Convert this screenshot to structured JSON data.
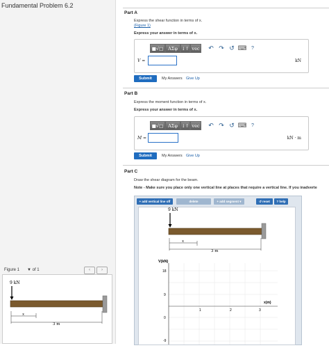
{
  "left": {
    "problem_title": "Fundamental Problem 6.2",
    "figure_label": "Figure 1",
    "figure_of": "of 1",
    "figure": {
      "load_label": "9 kN",
      "x_label": "x",
      "length_label": "3 m"
    }
  },
  "part_a": {
    "title": "Part A",
    "prompt": "Express the shear function in terms of x.",
    "figure_link": "(Figure 1)",
    "instruction": "Express your answer in terms of x.",
    "variable": "V =",
    "input_value": "",
    "unit": "kN",
    "submit": "Submit",
    "my_answers": "My Answers",
    "give_up": "Give Up"
  },
  "part_b": {
    "title": "Part B",
    "prompt": "Express the moment function in terms of x.",
    "instruction": "Express your answer in terms of x.",
    "variable": "M =",
    "input_value": "",
    "unit": "kN · m",
    "submit": "Submit",
    "my_answers": "My Answers",
    "give_up": "Give Up"
  },
  "toolbar": {
    "templates": "■√□",
    "greek": "ΑΣφ",
    "arrows": "↓↑",
    "vec": "vec",
    "undo": "↶",
    "redo": "↷",
    "reset": "↺",
    "keyboard": "⌨",
    "help": "?"
  },
  "part_c": {
    "title": "Part C",
    "prompt": "Draw the shear diagram for the beam.",
    "note": "Note - Make sure you place only one vertical line at places that require a vertical line. If you inadverte",
    "tools": {
      "add_vertical": "+ add vertical line off",
      "delete": "delete",
      "add_segment": "+ add segment ▾",
      "reset": "↺ reset",
      "help": "? help"
    },
    "diagram": {
      "load_label": "9 kN",
      "x_label": "x",
      "length_label": "3 m",
      "y_axis_label": "V(kN)",
      "x_axis_label": "x(m)",
      "y_ticks": [
        "18",
        "9",
        "0",
        "-9"
      ],
      "x_ticks": [
        "1",
        "2",
        "3"
      ]
    }
  },
  "colors": {
    "submit_blue": "#1f6cbf",
    "beam": "#7b5a2e",
    "wall": "#9a9a9a"
  }
}
